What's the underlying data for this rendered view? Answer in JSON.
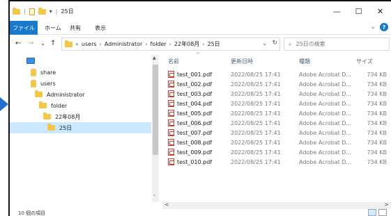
{
  "window": {
    "title": "25日",
    "quick_access_separator": "|",
    "pin_glyph": "▾",
    "buttons": {
      "minimize": "—",
      "maximize": "☐",
      "close": "✕"
    }
  },
  "ribbon": {
    "tabs": [
      "ファイル",
      "ホーム",
      "共有",
      "表示"
    ],
    "expand_glyph": "⌄",
    "help_glyph": "?"
  },
  "nav": {
    "back": "←",
    "forward": "→",
    "history": "⌄",
    "up": "↑",
    "address": {
      "overflow": "«",
      "crumbs": [
        "users",
        "Administrator",
        "folder",
        "22年08月",
        "25日"
      ],
      "separator": "›",
      "dropdown": "⌄",
      "refresh": "↻"
    },
    "search": {
      "icon": "⌕",
      "placeholder": "25日の検索"
    }
  },
  "tree": {
    "items": [
      {
        "label": "",
        "icon": "pc-icon"
      },
      {
        "label": "share",
        "icon": "user-folder-icon"
      },
      {
        "label": "users",
        "icon": "user-folder-icon"
      },
      {
        "label": "Administrator",
        "icon": "folder-icon"
      },
      {
        "label": "folder",
        "icon": "folder-icon"
      },
      {
        "label": "22年08月",
        "icon": "folder-icon"
      },
      {
        "label": "25日",
        "icon": "folder-icon",
        "selected": true
      }
    ],
    "scroll_up": "▲",
    "scroll_down": "⌄"
  },
  "files": {
    "columns": {
      "name": "名前",
      "date": "更新日時",
      "type": "種類",
      "size": "サイズ"
    },
    "sort_indicator": "^",
    "rows": [
      {
        "name": "test_001.pdf",
        "date": "2022/08/25 17:41",
        "type": "Adobe Acrobat D...",
        "size": "734 KB"
      },
      {
        "name": "test_002.pdf",
        "date": "2022/08/25 17:41",
        "type": "Adobe Acrobat D...",
        "size": "734 KB"
      },
      {
        "name": "test_003.pdf",
        "date": "2022/08/25 17:41",
        "type": "Adobe Acrobat D...",
        "size": "734 KB"
      },
      {
        "name": "test_004.pdf",
        "date": "2022/08/25 17:41",
        "type": "Adobe Acrobat D...",
        "size": "734 KB"
      },
      {
        "name": "test_005.pdf",
        "date": "2022/08/25 17:41",
        "type": "Adobe Acrobat D...",
        "size": "734 KB"
      },
      {
        "name": "test_006.pdf",
        "date": "2022/08/25 17:41",
        "type": "Adobe Acrobat D...",
        "size": "734 KB"
      },
      {
        "name": "test_007.pdf",
        "date": "2022/08/25 17:41",
        "type": "Adobe Acrobat D...",
        "size": "734 KB"
      },
      {
        "name": "test_008.pdf",
        "date": "2022/08/25 17:41",
        "type": "Adobe Acrobat D...",
        "size": "734 KB"
      },
      {
        "name": "test_009.pdf",
        "date": "2022/08/25 17:41",
        "type": "Adobe Acrobat D...",
        "size": "734 KB"
      },
      {
        "name": "test_010.pdf",
        "date": "2022/08/25 17:41",
        "type": "Adobe Acrobat D...",
        "size": "734 KB"
      }
    ],
    "hscroll_left": "<",
    "hscroll_right": ">"
  },
  "status": {
    "item_count": "10 個の項目"
  },
  "colors": {
    "accent": "#1979ca",
    "selection": "#cce8ff",
    "pdf": "#d0342c",
    "folder": "#f2c74a",
    "pointer": "#1f6fd2"
  }
}
